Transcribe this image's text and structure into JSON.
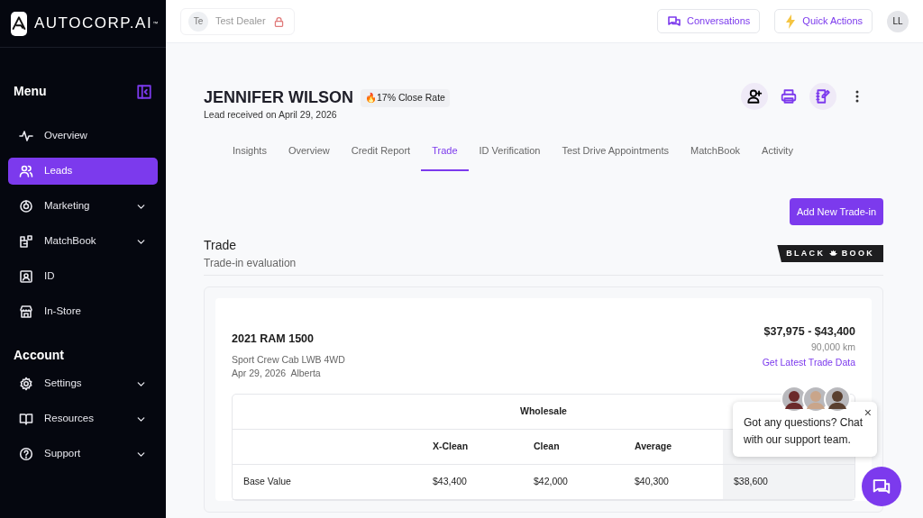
{
  "brand": {
    "name": "AUTOCORP.AI",
    "mark": "™"
  },
  "sidebar": {
    "sections": [
      {
        "title": "Menu",
        "items": [
          {
            "label": "Overview",
            "selected": false,
            "expandable": false
          },
          {
            "label": "Leads",
            "selected": true,
            "expandable": false
          },
          {
            "label": "Marketing",
            "selected": false,
            "expandable": true
          },
          {
            "label": "MatchBook",
            "selected": false,
            "expandable": true
          },
          {
            "label": "ID",
            "selected": false,
            "expandable": false
          },
          {
            "label": "In-Store",
            "selected": false,
            "expandable": false
          }
        ]
      },
      {
        "title": "Account",
        "items": [
          {
            "label": "Settings",
            "selected": false,
            "expandable": true
          },
          {
            "label": "Resources",
            "selected": false,
            "expandable": true
          },
          {
            "label": "Support",
            "selected": false,
            "expandable": true
          }
        ]
      }
    ]
  },
  "topbar": {
    "dealer_initials": "Te",
    "dealer": "Test Dealer",
    "buttons": [
      "Conversations",
      "Quick Actions"
    ],
    "user_initials": "LL"
  },
  "lead": {
    "name": "JENNIFER WILSON",
    "received": "Lead received on April 29, 2026",
    "close_rate": "🔥17% Close Rate"
  },
  "tabs": [
    {
      "label": "Insights",
      "selected": false
    },
    {
      "label": "Overview",
      "selected": false
    },
    {
      "label": "Credit Report",
      "selected": false
    },
    {
      "label": "Trade",
      "selected": true
    },
    {
      "label": "ID Verification",
      "selected": false
    },
    {
      "label": "Test Drive Appointments",
      "selected": false
    },
    {
      "label": "MatchBook",
      "selected": false
    },
    {
      "label": "Activity",
      "selected": false
    }
  ],
  "add_button": "Add New Trade-in",
  "section": {
    "title": "Trade",
    "subtitle": "Trade-in evaluation",
    "logo_left": "BLACK",
    "logo_right": "BOOK"
  },
  "vehicle": {
    "title": "2021 RAM 1500",
    "trim": "Sport Crew Cab LWB 4WD",
    "date": "Apr 29, 2026",
    "region": "Alberta",
    "price_range": "$37,975 - $43,400",
    "mileage": "90,000 km",
    "link": "Get Latest Trade Data"
  },
  "table": {
    "group": "Wholesale",
    "columns": [
      "X-Clean",
      "Clean",
      "Average"
    ],
    "rows": [
      {
        "label": "Base Value",
        "cells": [
          "$43,400",
          "$42,000",
          "$40,300",
          "$38,600"
        ]
      }
    ]
  },
  "chat": {
    "message": "Got any questions? Chat with our support team.",
    "close": "×"
  }
}
